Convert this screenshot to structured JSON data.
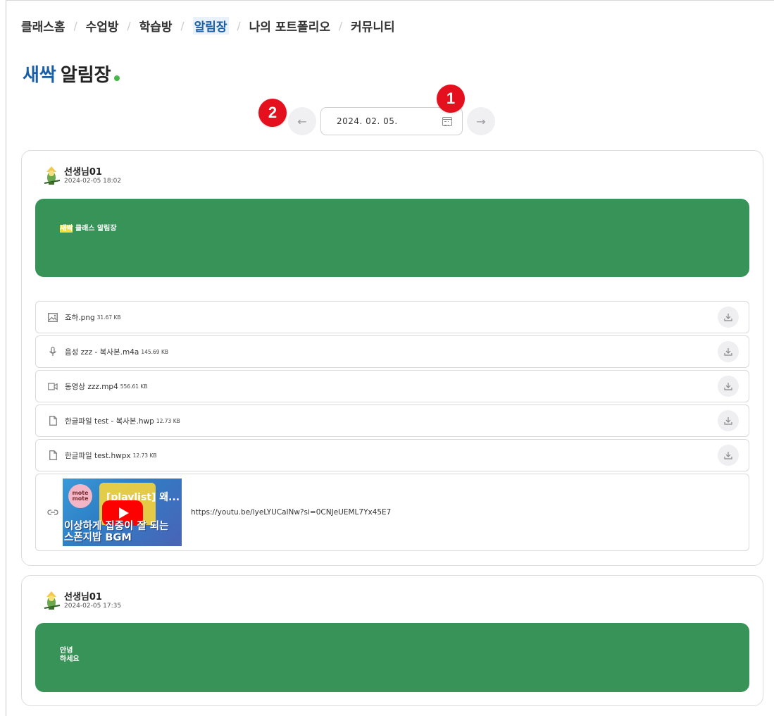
{
  "breadcrumb": {
    "items": [
      "클래스홈",
      "수업방",
      "학습방",
      "알림장",
      "나의 포트폴리오",
      "커뮤니티"
    ],
    "active": "알림장"
  },
  "page": {
    "title_accent": "새싹",
    "title_main": "알림장"
  },
  "date_nav": {
    "date": "2024. 02. 05.",
    "prev": "←",
    "next": "→"
  },
  "badges": {
    "one": "1",
    "two": "2"
  },
  "posts": [
    {
      "author": "선생님01",
      "time": "2024-02-05 18:02",
      "body_highlight": "새싹",
      "body_rest": " 클래스 알림장",
      "attachments": [
        {
          "icon": "image-icon",
          "name": "죠하.png",
          "size": "31.67 KB"
        },
        {
          "icon": "microphone-icon",
          "name": "음성 zzz - 복사본.m4a",
          "size": "145.69 KB"
        },
        {
          "icon": "video-icon",
          "name": "동영상 zzz.mp4",
          "size": "556.61 KB"
        },
        {
          "icon": "file-icon",
          "name": "한글파일 test - 복사본.hwp",
          "size": "12.73 KB"
        },
        {
          "icon": "file-icon",
          "name": "한글파일 test.hwpx",
          "size": "12.73 KB"
        }
      ],
      "link": {
        "url": "https://youtu.be/lyeLYUCalNw?si=0CNJeUEML7Yx45E7",
        "thumb_badge": "mote mote",
        "thumb_title": "[playlist] 왜...",
        "thumb_caption_1": "이상하게 집중이 잘 되는",
        "thumb_caption_2": "스폰지밥 BGM"
      }
    },
    {
      "author": "선생님01",
      "time": "2024-02-05 17:35",
      "body_line1": "안녕",
      "body_line2": "하세요"
    }
  ],
  "colors": {
    "accent": "#1b5ea8",
    "post_bg": "#389358",
    "badge": "#e4101d",
    "dot": "#49b649"
  }
}
